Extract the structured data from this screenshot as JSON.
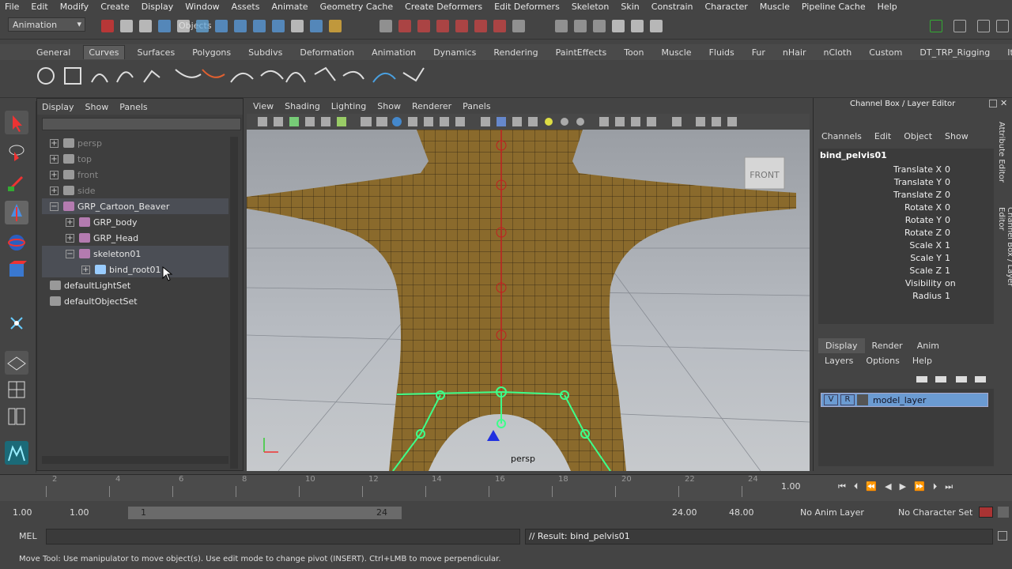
{
  "menubar": [
    "File",
    "Edit",
    "Modify",
    "Create",
    "Display",
    "Window",
    "Assets",
    "Animate",
    "Geometry Cache",
    "Create Deformers",
    "Edit Deformers",
    "Skeleton",
    "Skin",
    "Constrain",
    "Character",
    "Muscle",
    "Pipeline Cache",
    "Help"
  ],
  "status": {
    "mode": "Animation",
    "selection_mode": "Objects"
  },
  "shelf_tabs": [
    "General",
    "Curves",
    "Surfaces",
    "Polygons",
    "Subdivs",
    "Deformation",
    "Animation",
    "Dynamics",
    "Rendering",
    "PaintEffects",
    "Toon",
    "Muscle",
    "Fluids",
    "Fur",
    "nHair",
    "nCloth",
    "Custom",
    "DT_TRP_Rigging",
    "Item"
  ],
  "shelf_active": "Curves",
  "outliner": {
    "menu": [
      "Display",
      "Show",
      "Panels"
    ],
    "items": [
      {
        "label": "persp",
        "depth": 0,
        "expander": "+",
        "dim": true
      },
      {
        "label": "top",
        "depth": 0,
        "expander": "+",
        "dim": true
      },
      {
        "label": "front",
        "depth": 0,
        "expander": "+",
        "dim": true
      },
      {
        "label": "side",
        "depth": 0,
        "expander": "+",
        "dim": true
      },
      {
        "label": "GRP_Cartoon_Beaver",
        "depth": 0,
        "expander": "−",
        "dim": false
      },
      {
        "label": "GRP_body",
        "depth": 1,
        "expander": "+",
        "dim": false
      },
      {
        "label": "GRP_Head",
        "depth": 1,
        "expander": "+",
        "dim": false
      },
      {
        "label": "skeleton01",
        "depth": 1,
        "expander": "−",
        "dim": false
      },
      {
        "label": "bind_root01",
        "depth": 2,
        "expander": "+",
        "dim": false
      },
      {
        "label": "defaultLightSet",
        "depth": 0,
        "expander": "",
        "dim": false
      },
      {
        "label": "defaultObjectSet",
        "depth": 0,
        "expander": "",
        "dim": false
      }
    ]
  },
  "viewport": {
    "menu": [
      "View",
      "Shading",
      "Lighting",
      "Show",
      "Renderer",
      "Panels"
    ],
    "camera_label": "persp",
    "cube_label": "FRONT"
  },
  "channel_box": {
    "title": "Channel Box / Layer Editor",
    "menu": [
      "Channels",
      "Edit",
      "Object",
      "Show"
    ],
    "object": "bind_pelvis01",
    "attributes": [
      {
        "name": "Translate X",
        "value": "0"
      },
      {
        "name": "Translate Y",
        "value": "0"
      },
      {
        "name": "Translate Z",
        "value": "0"
      },
      {
        "name": "Rotate X",
        "value": "0"
      },
      {
        "name": "Rotate Y",
        "value": "0"
      },
      {
        "name": "Rotate Z",
        "value": "0"
      },
      {
        "name": "Scale X",
        "value": "1"
      },
      {
        "name": "Scale Y",
        "value": "1"
      },
      {
        "name": "Scale Z",
        "value": "1"
      },
      {
        "name": "Visibility",
        "value": "on"
      },
      {
        "name": "Radius",
        "value": "1"
      }
    ],
    "layer_tabs": [
      "Display",
      "Render",
      "Anim"
    ],
    "layer_menu": [
      "Layers",
      "Options",
      "Help"
    ],
    "layer": {
      "v": "V",
      "r": "R",
      "name": "model_layer"
    },
    "side_tabs": [
      "Attribute Editor",
      "Channel Box / Layer Editor"
    ]
  },
  "timeline": {
    "ticks": [
      "2",
      "4",
      "6",
      "8",
      "10",
      "12",
      "14",
      "16",
      "18",
      "20",
      "22",
      "24"
    ],
    "current": "1.00"
  },
  "range": {
    "start": "1.00",
    "start2": "1.00",
    "slider_start": "1",
    "slider_end": "24",
    "end": "24.00",
    "end2": "48.00",
    "anim_layer": "No Anim Layer",
    "char_set": "No Character Set"
  },
  "command": {
    "lang": "MEL",
    "result": "// Result: bind_pelvis01"
  },
  "help": "Move Tool: Use manipulator to move object(s). Use edit mode to change pivot (INSERT). Ctrl+LMB to move perpendicular."
}
